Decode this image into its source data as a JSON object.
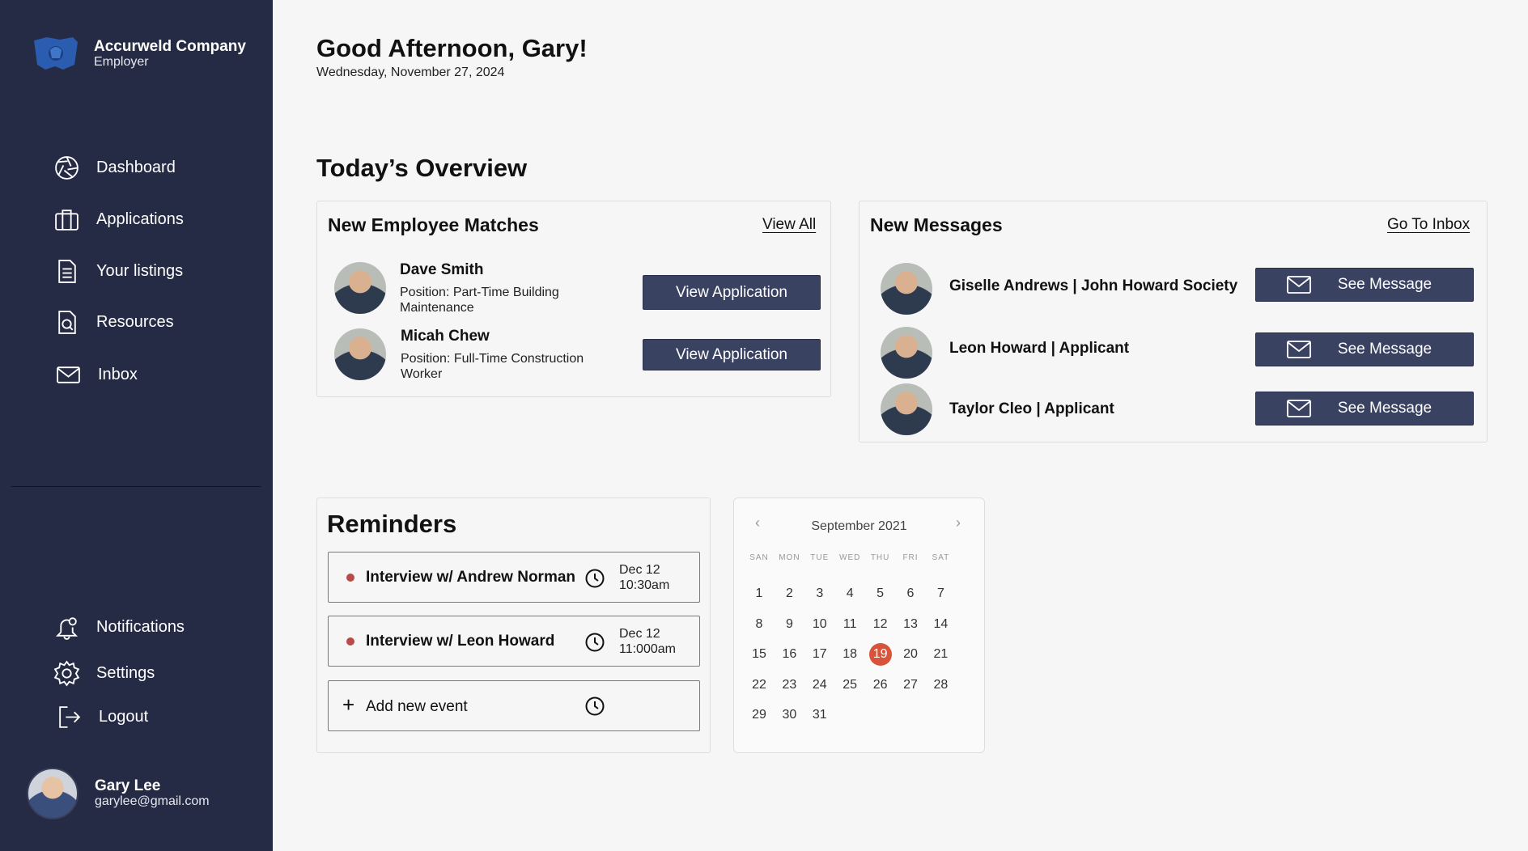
{
  "brand": {
    "name": "Accurweld Company",
    "role": "Employer"
  },
  "nav": {
    "dashboard": "Dashboard",
    "applications": "Applications",
    "listings": "Your listings",
    "resources": "Resources",
    "inbox": "Inbox",
    "notifications": "Notifications",
    "settings": "Settings",
    "logout": "Logout"
  },
  "user": {
    "name": "Gary Lee",
    "email": "garylee@gmail.com"
  },
  "header": {
    "greeting": "Good Afternoon, Gary!",
    "date": "Wednesday, November 27, 2024"
  },
  "overview": {
    "title": "Today’s Overview"
  },
  "matches": {
    "title": "New Employee Matches",
    "view_all": "View All",
    "items": [
      {
        "name": "Dave Smith",
        "position": "Position: Part-Time Building Maintenance",
        "button": "View Application"
      },
      {
        "name": "Micah Chew",
        "position": "Position: Full-Time Construction Worker",
        "button": "View Application"
      }
    ]
  },
  "messages": {
    "title": "New Messages",
    "go_inbox": "Go To Inbox",
    "items": [
      {
        "name": "Giselle Andrews | John Howard Society",
        "button": "See Message"
      },
      {
        "name": "Leon Howard | Applicant",
        "button": "See Message"
      },
      {
        "name": "Taylor Cleo | Applicant",
        "button": "See Message"
      }
    ]
  },
  "reminders": {
    "title": "Reminders",
    "items": [
      {
        "text": "Interview w/ Andrew Norman",
        "date": "Dec 12",
        "time": "10:30am"
      },
      {
        "text": "Interview w/ Leon Howard",
        "date": "Dec 12",
        "time": "11:000am"
      }
    ],
    "add_label": "Add new event"
  },
  "calendar": {
    "month_label": "September 2021",
    "weekdays": [
      "SAN",
      "MON",
      "TUE",
      "WED",
      "THU",
      "FRI",
      "SAT"
    ],
    "days_in_month": 31,
    "first_weekday_index": 0,
    "selected_day": 19,
    "selected_color": "#d9533a"
  },
  "colors": {
    "sidebar": "#262b45",
    "button": "#3a4262",
    "accent": "#d9533a",
    "reminder_dot": "#b94a48"
  }
}
